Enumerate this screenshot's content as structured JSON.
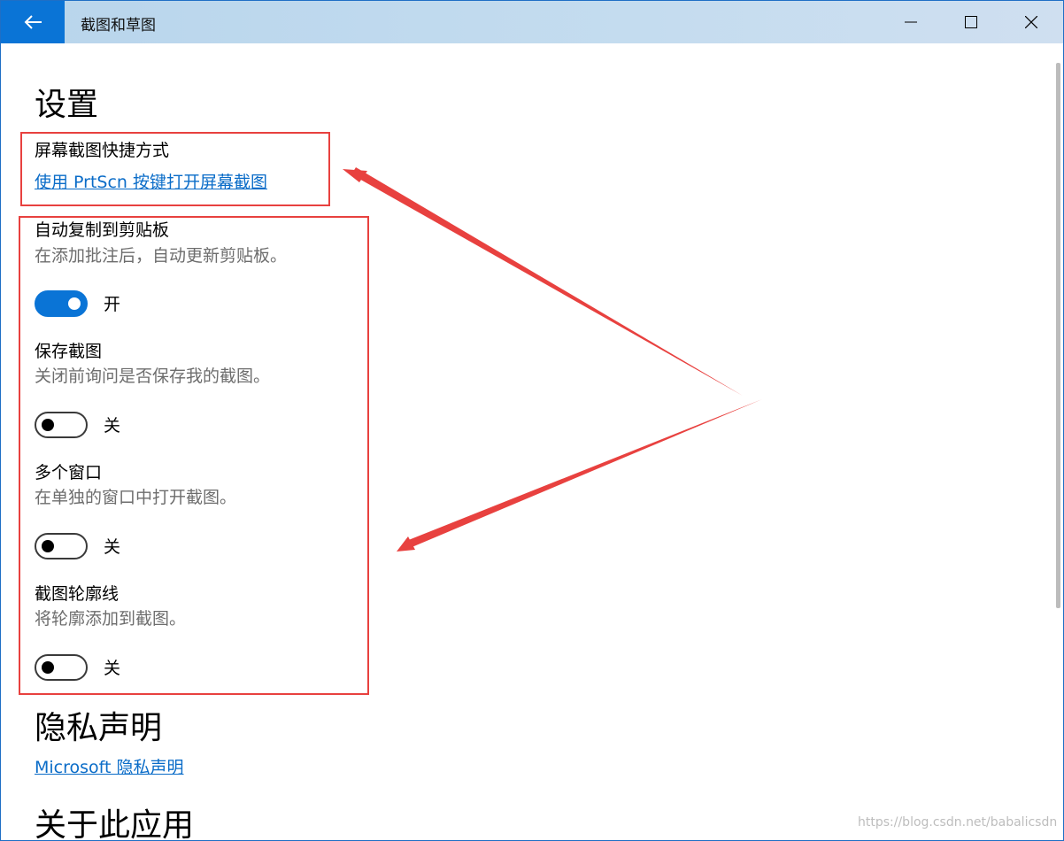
{
  "window": {
    "title": "截图和草图"
  },
  "settings": {
    "heading": "设置",
    "shortcut": {
      "label": "屏幕截图快捷方式",
      "link": "使用 PrtScn 按键打开屏幕截图"
    },
    "toggles": [
      {
        "label": "自动复制到剪贴板",
        "desc": "在添加批注后，自动更新剪贴板。",
        "state": "开",
        "on": true
      },
      {
        "label": "保存截图",
        "desc": "关闭前询问是否保存我的截图。",
        "state": "关",
        "on": false
      },
      {
        "label": "多个窗口",
        "desc": "在单独的窗口中打开截图。",
        "state": "关",
        "on": false
      },
      {
        "label": "截图轮廓线",
        "desc": "将轮廓添加到截图。",
        "state": "关",
        "on": false
      }
    ]
  },
  "privacy": {
    "heading": "隐私声明",
    "link": "Microsoft 隐私声明"
  },
  "about": {
    "heading": "关于此应用"
  },
  "watermark": "https://blog.csdn.net/babalicsdn",
  "colors": {
    "accent": "#0a74d6",
    "annotation": "#e8413f",
    "link": "#0a6cc8"
  }
}
